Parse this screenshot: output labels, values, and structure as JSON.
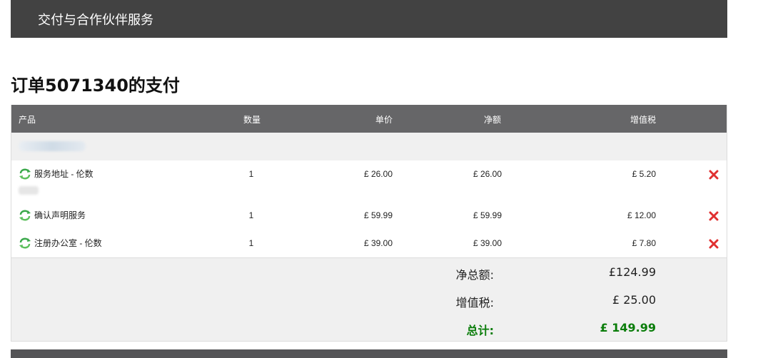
{
  "header": {
    "title": "交付与合作伙伴服务"
  },
  "page": {
    "title": "订单5071340的支付"
  },
  "table": {
    "columns": {
      "product": "产品",
      "quantity": "数量",
      "unit_price": "单价",
      "net": "净额",
      "vat": "增值税"
    },
    "rows": [
      {
        "product": "服务地址 - 伦数",
        "quantity": "1",
        "unit_price": "£ 26.00",
        "net": "£ 26.00",
        "vat": "£ 5.20"
      },
      {
        "product": "确认声明服务",
        "quantity": "1",
        "unit_price": "£ 59.99",
        "net": "£ 59.99",
        "vat": "£ 12.00"
      },
      {
        "product": "注册办公室 - 伦数",
        "quantity": "1",
        "unit_price": "£ 39.00",
        "net": "£ 39.00",
        "vat": "£ 7.80"
      }
    ]
  },
  "totals": {
    "net_label": "净总额:",
    "net_value": "£124.99",
    "vat_label": "增值税:",
    "vat_value": "£ 25.00",
    "total_label": "总计:",
    "total_value": "£ 149.99"
  },
  "colors": {
    "header_bg": "#424242",
    "table_head_bg": "#666668",
    "total_green": "#0a7d0a",
    "delete_red": "#e03030",
    "renew_green": "#3aa84a"
  },
  "icons": {
    "renew": "renew-icon",
    "delete": "delete-icon"
  }
}
